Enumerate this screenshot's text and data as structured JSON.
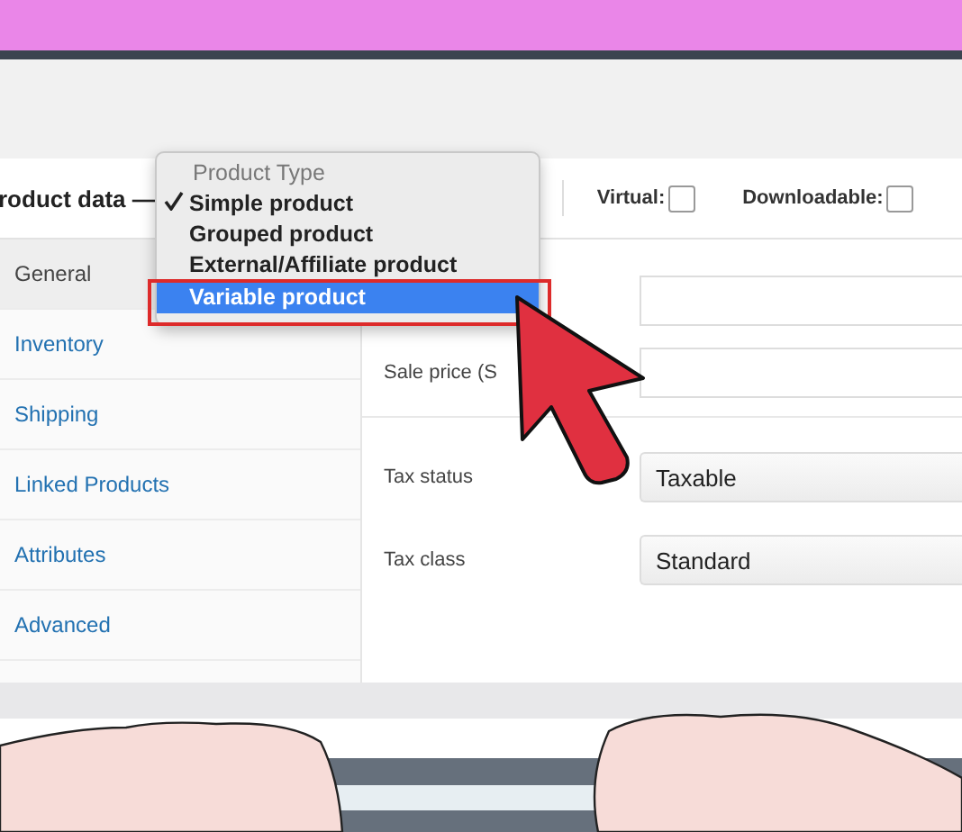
{
  "header": {
    "title": "roduct data —",
    "checkboxes": [
      {
        "label": "Virtual:",
        "checked": false
      },
      {
        "label": "Downloadable:",
        "checked": false
      }
    ]
  },
  "menu": {
    "title": "Product Type",
    "items": [
      {
        "label": "Simple product",
        "checked": true,
        "selected": false
      },
      {
        "label": "Grouped product",
        "checked": false,
        "selected": false
      },
      {
        "label": "External/Affiliate product",
        "checked": false,
        "selected": false
      },
      {
        "label": "Variable product",
        "checked": false,
        "selected": true
      }
    ]
  },
  "tabs": [
    {
      "label": "General",
      "selected": true
    },
    {
      "label": "Inventory",
      "selected": false
    },
    {
      "label": "Shipping",
      "selected": false
    },
    {
      "label": "Linked Products",
      "selected": false
    },
    {
      "label": "Attributes",
      "selected": false
    },
    {
      "label": "Advanced",
      "selected": false
    }
  ],
  "fields": [
    {
      "kind": "input"
    },
    {
      "kind": "input",
      "label": "Sale price (S"
    },
    {
      "kind": "divider"
    },
    {
      "kind": "select",
      "label": "Tax status",
      "value": "Taxable"
    },
    {
      "kind": "select",
      "label": "Tax class",
      "value": "Standard"
    }
  ]
}
